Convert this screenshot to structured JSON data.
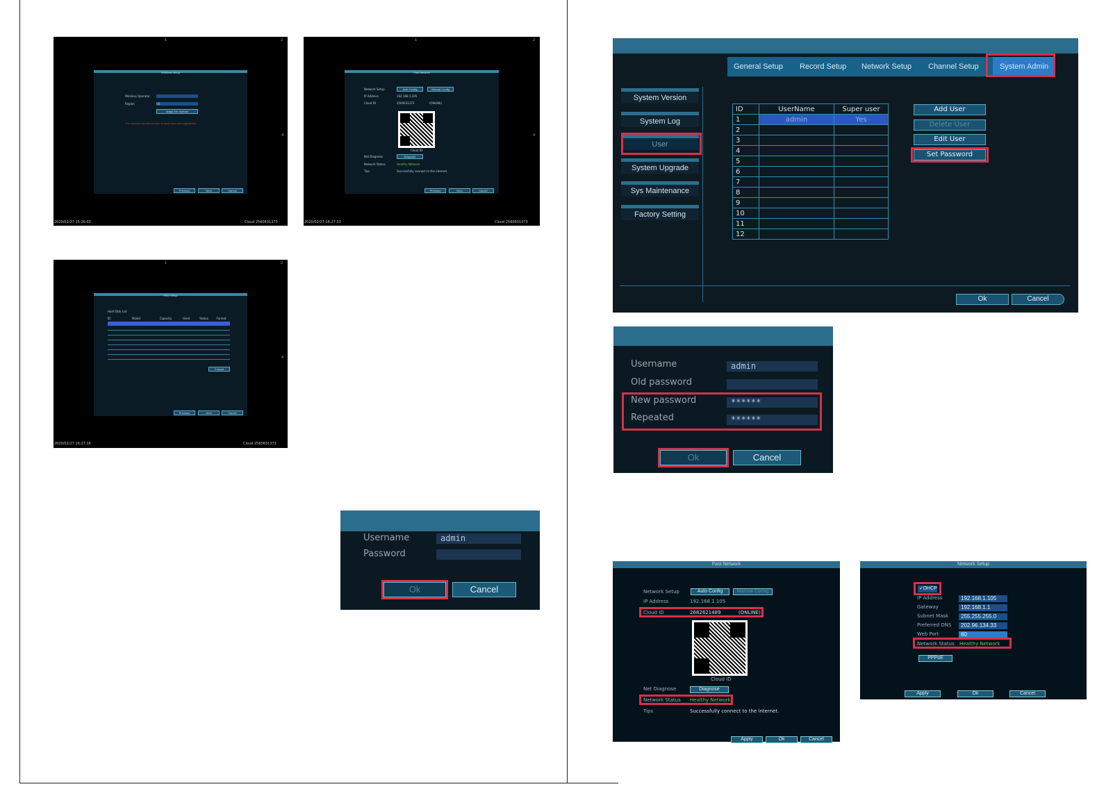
{
  "screen1": {
    "num1": "1",
    "num2": "2",
    "num4": "4",
    "title": "Wireless Setup",
    "row1_label": "Wireless Operator",
    "row2_label": "Region",
    "row2_val": "US",
    "adapt_btn": "Adapt the channel",
    "warning": "The channel should conform to local laws and regulations.",
    "btn_prev": "Previous",
    "btn_next": "Next",
    "btn_cancel": "Cancel",
    "timestamp": "2020/02/27 15:26:03",
    "cloud": "Cloud 2560631373"
  },
  "screen2": {
    "num1": "1",
    "num2": "2",
    "num4": "4",
    "title": "Fast Network",
    "l1": "Network Setup",
    "b1": "Auto Config",
    "b2": "Manual Config",
    "l2": "IP Address",
    "v2": "192.168.1.105",
    "l3": "Cloud ID",
    "v3": "2560631373",
    "v3s": "(ONLINE)",
    "qr_label": "Cloud ID",
    "l4": "Net Diagnose",
    "b4": "Diagnose",
    "l5": "Network Status",
    "v5": "Healthy Network",
    "l6": "Tips",
    "v6": "Successfully connect to the internet.",
    "btn_prev": "Previous",
    "btn_next": "Next",
    "btn_cancel": "Cancel",
    "timestamp": "2020/02/27 16:27:53",
    "cloud": "Cloud 2560631373"
  },
  "screen3": {
    "num1": "1",
    "num2": "2",
    "num4": "4",
    "title": "HDD Setup",
    "sub": "Hard Disk List",
    "cols": [
      "ID",
      "Model",
      "Capacity",
      "Used",
      "Status",
      "Format"
    ],
    "format_btn": "Format",
    "btn_prev": "Previous",
    "btn_next": "Next",
    "btn_cancel": "Cancel",
    "timestamp": "2020/02/27 16:27:16",
    "cloud": "Cloud 2560631373"
  },
  "login": {
    "username_label": "Username",
    "username_value": "admin",
    "password_label": "Password",
    "ok": "Ok",
    "cancel": "Cancel"
  },
  "sysadmin": {
    "tabs": [
      "General Setup",
      "Record Setup",
      "Network Setup",
      "Channel Setup",
      "System Admin"
    ],
    "side": [
      "System Version",
      "System Log",
      "User",
      "System Upgrade",
      "Sys Maintenance",
      "Factory Setting"
    ],
    "table_headers": [
      "ID",
      "UserName",
      "Super user"
    ],
    "rows": [
      [
        "1",
        "admin",
        "Yes"
      ],
      [
        "2",
        "",
        ""
      ],
      [
        "3",
        "",
        ""
      ],
      [
        "4",
        "",
        ""
      ],
      [
        "5",
        "",
        ""
      ],
      [
        "6",
        "",
        ""
      ],
      [
        "7",
        "",
        ""
      ],
      [
        "8",
        "",
        ""
      ],
      [
        "9",
        "",
        ""
      ],
      [
        "10",
        "",
        ""
      ],
      [
        "11",
        "",
        ""
      ],
      [
        "12",
        "",
        ""
      ]
    ],
    "actions": [
      "Add User",
      "Delete User",
      "Edit User",
      "Set Password"
    ],
    "ok": "Ok",
    "cancel": "Cancel"
  },
  "setpwd": {
    "username_label": "Username",
    "username_value": "admin",
    "old_label": "Old password",
    "new_label": "New password",
    "new_value": "******",
    "rep_label": "Repeated",
    "rep_value": "******",
    "ok": "Ok",
    "cancel": "Cancel"
  },
  "fastnet": {
    "title": "Fast Network",
    "l1": "Network Setup",
    "b1": "Auto Config",
    "b2": "Manual Config",
    "l2": "IP Address",
    "v2": "192.168.1.105",
    "l3": "Cloud ID",
    "v3": "2682621489",
    "v3s": "(ONLINE)",
    "qr_label": "Cloud ID",
    "l4": "Net Diagnose",
    "b4": "Diagnose",
    "l5": "Network Status",
    "v5": "Healthy Network",
    "l6": "Tips",
    "v6": "Successfully connect to the internet.",
    "apply": "Apply",
    "ok": "Ok",
    "cancel": "Cancel"
  },
  "netsetup": {
    "title": "Network Setup",
    "dhcp": "DHCP",
    "ip_label": "IP Address",
    "ip": "192.168.1.105",
    "gw_label": "Gateway",
    "gw": "192.168.1.1",
    "mask_label": "Subnet Mask",
    "mask": "255.255.255.0",
    "dns_label": "Preferred DNS",
    "dns": "202.96.134.33",
    "web_label": "Web Port",
    "web": "80",
    "status_label": "Network Status",
    "status": "Healthy Network",
    "pppoe": "PPPoE",
    "apply": "Apply",
    "ok": "Ok",
    "cancel": "Cancel"
  }
}
